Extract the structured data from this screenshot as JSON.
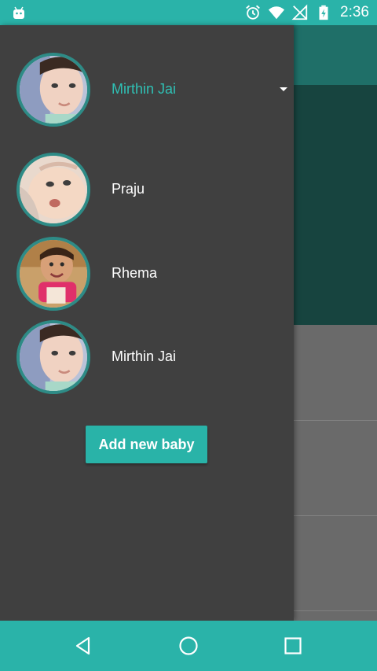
{
  "status_bar": {
    "time": "2:36",
    "icons": [
      "android-debug-icon",
      "alarm-icon",
      "wifi-icon",
      "no-signal-icon",
      "battery-charging-icon"
    ],
    "color": "#2ab3a9"
  },
  "drawer": {
    "selected_baby": {
      "name": "Mirthin Jai",
      "avatar": "baby-photo-mirthin"
    },
    "babies": [
      {
        "name": "Praju",
        "avatar": "baby-photo-praju"
      },
      {
        "name": "Rhema",
        "avatar": "baby-photo-rhema"
      },
      {
        "name": "Mirthin Jai",
        "avatar": "baby-photo-mirthin"
      }
    ],
    "add_button_label": "Add new baby",
    "accent_color": "#2fc0b4",
    "background": "#404040"
  },
  "nav_bar": {
    "buttons": [
      "back-icon",
      "home-icon",
      "recents-icon"
    ],
    "color": "#2ab3a9"
  }
}
